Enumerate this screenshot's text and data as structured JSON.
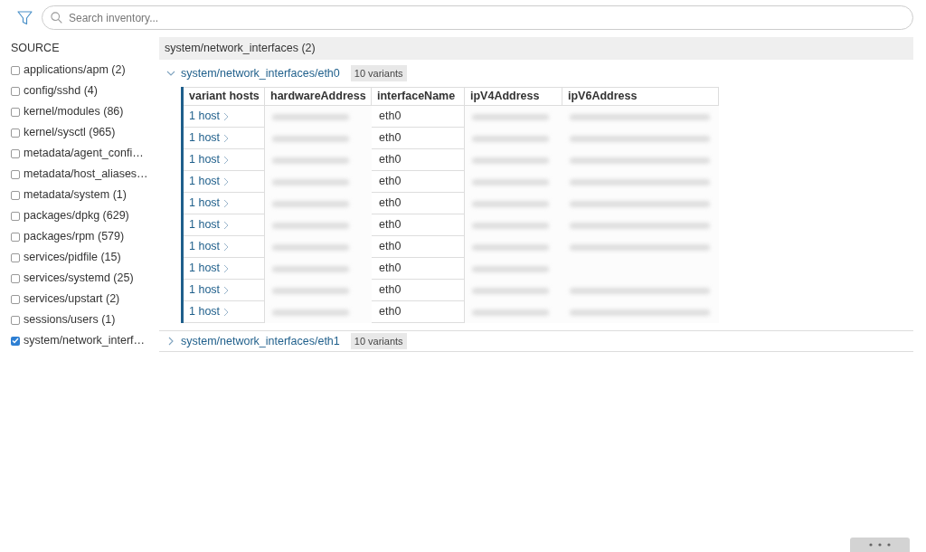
{
  "search": {
    "placeholder": "Search inventory..."
  },
  "sidebar": {
    "title": "SOURCE",
    "items": [
      {
        "label": "applications/apm (2)",
        "checked": false
      },
      {
        "label": "config/sshd (4)",
        "checked": false
      },
      {
        "label": "kernel/modules (86)",
        "checked": false
      },
      {
        "label": "kernel/sysctl (965)",
        "checked": false
      },
      {
        "label": "metadata/agent_confi…",
        "checked": false
      },
      {
        "label": "metadata/host_aliases…",
        "checked": false
      },
      {
        "label": "metadata/system (1)",
        "checked": false
      },
      {
        "label": "packages/dpkg (629)",
        "checked": false
      },
      {
        "label": "packages/rpm (579)",
        "checked": false
      },
      {
        "label": "services/pidfile (15)",
        "checked": false
      },
      {
        "label": "services/systemd (25)",
        "checked": false
      },
      {
        "label": "services/upstart (2)",
        "checked": false
      },
      {
        "label": "sessions/users (1)",
        "checked": false
      },
      {
        "label": "system/network_interf…",
        "checked": true
      }
    ]
  },
  "main": {
    "header": "system/network_interfaces (2)",
    "groups": [
      {
        "title": "system/network_interfaces/eth0",
        "badge": "10 variants",
        "expanded": true,
        "table": {
          "columns": [
            "variant hosts",
            "hardwareAddress",
            "interfaceName",
            "ipV4Address",
            "ipV6Address"
          ],
          "rows": [
            {
              "cells": [
                {
                  "kind": "link",
                  "text": "1 host"
                },
                {
                  "kind": "redacted"
                },
                {
                  "kind": "text",
                  "text": "eth0"
                },
                {
                  "kind": "redacted"
                },
                {
                  "kind": "redacted"
                }
              ]
            },
            {
              "cells": [
                {
                  "kind": "link",
                  "text": "1 host"
                },
                {
                  "kind": "redacted"
                },
                {
                  "kind": "text",
                  "text": "eth0"
                },
                {
                  "kind": "redacted"
                },
                {
                  "kind": "redacted"
                }
              ]
            },
            {
              "cells": [
                {
                  "kind": "link",
                  "text": "1 host"
                },
                {
                  "kind": "redacted"
                },
                {
                  "kind": "text",
                  "text": "eth0"
                },
                {
                  "kind": "redacted"
                },
                {
                  "kind": "redacted"
                }
              ]
            },
            {
              "cells": [
                {
                  "kind": "link",
                  "text": "1 host"
                },
                {
                  "kind": "redacted"
                },
                {
                  "kind": "text",
                  "text": "eth0"
                },
                {
                  "kind": "redacted"
                },
                {
                  "kind": "redacted"
                }
              ]
            },
            {
              "cells": [
                {
                  "kind": "link",
                  "text": "1 host"
                },
                {
                  "kind": "redacted"
                },
                {
                  "kind": "text",
                  "text": "eth0"
                },
                {
                  "kind": "redacted"
                },
                {
                  "kind": "redacted"
                }
              ]
            },
            {
              "cells": [
                {
                  "kind": "link",
                  "text": "1 host"
                },
                {
                  "kind": "redacted"
                },
                {
                  "kind": "text",
                  "text": "eth0"
                },
                {
                  "kind": "redacted"
                },
                {
                  "kind": "redacted"
                }
              ]
            },
            {
              "cells": [
                {
                  "kind": "link",
                  "text": "1 host"
                },
                {
                  "kind": "redacted"
                },
                {
                  "kind": "text",
                  "text": "eth0"
                },
                {
                  "kind": "redacted"
                },
                {
                  "kind": "redacted"
                }
              ]
            },
            {
              "cells": [
                {
                  "kind": "link",
                  "text": "1 host"
                },
                {
                  "kind": "redacted"
                },
                {
                  "kind": "text",
                  "text": "eth0"
                },
                {
                  "kind": "redacted"
                },
                {
                  "kind": "empty"
                }
              ]
            },
            {
              "cells": [
                {
                  "kind": "link",
                  "text": "1 host"
                },
                {
                  "kind": "redacted"
                },
                {
                  "kind": "text",
                  "text": "eth0"
                },
                {
                  "kind": "redacted"
                },
                {
                  "kind": "redacted"
                }
              ]
            },
            {
              "cells": [
                {
                  "kind": "link",
                  "text": "1 host"
                },
                {
                  "kind": "redacted"
                },
                {
                  "kind": "text",
                  "text": "eth0"
                },
                {
                  "kind": "redacted"
                },
                {
                  "kind": "redacted"
                }
              ]
            }
          ]
        }
      },
      {
        "title": "system/network_interfaces/eth1",
        "badge": "10 variants",
        "expanded": false
      }
    ]
  }
}
